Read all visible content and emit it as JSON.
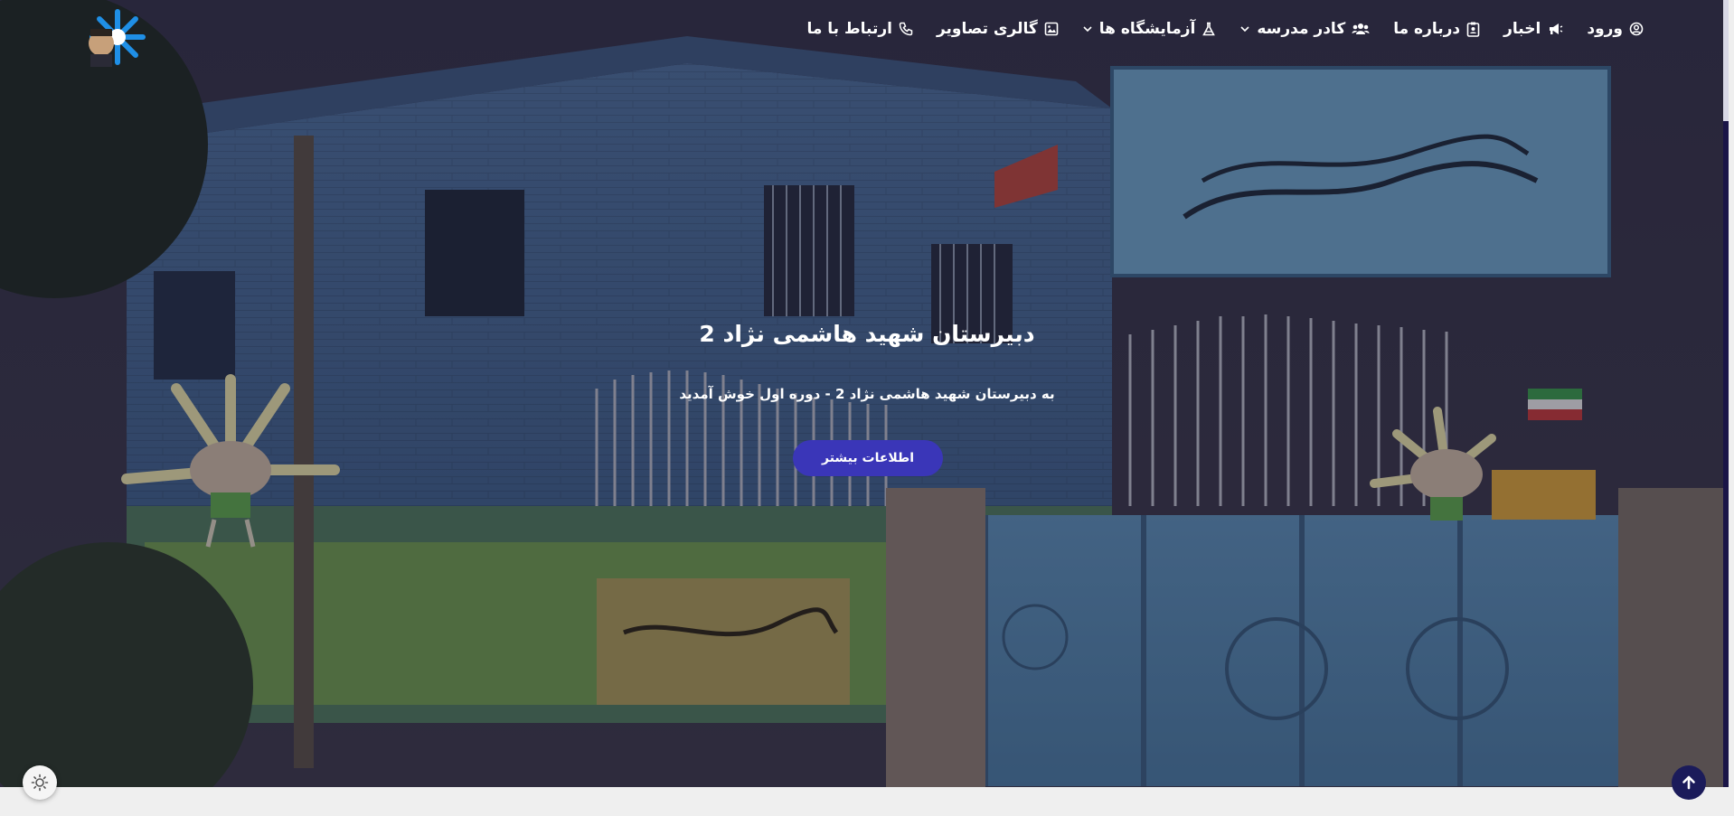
{
  "colors": {
    "accent": "#3a36b8",
    "nav_text": "#ffffff",
    "scroll_top_bg": "#1b1b5a",
    "page_bg": "#efefef"
  },
  "logo": {
    "icon": "school-logo-icon"
  },
  "nav": {
    "items": [
      {
        "label": "ورود",
        "icon": "user-circle-icon",
        "has_dropdown": false
      },
      {
        "label": "اخبار",
        "icon": "megaphone-icon",
        "has_dropdown": false
      },
      {
        "label": "درباره ما",
        "icon": "id-badge-icon",
        "has_dropdown": false
      },
      {
        "label": "کادر مدرسه",
        "icon": "people-icon",
        "has_dropdown": true
      },
      {
        "label": "آزمایشگاه ها",
        "icon": "flask-icon",
        "has_dropdown": true
      },
      {
        "label": "گالری تصاویر",
        "icon": "image-icon",
        "has_dropdown": false
      },
      {
        "label": "ارتباط با ما",
        "icon": "phone-icon",
        "has_dropdown": false
      }
    ]
  },
  "hero": {
    "title": "دبیرستان شهید هاشمی نژاد 2",
    "subtitle": "به دبیرستان شهید هاشمی نژاد 2 - دوره اول خوش آمدید",
    "button_label": "اطلاعات بیشتر"
  },
  "controls": {
    "theme_toggle_icon": "sun-icon",
    "scroll_top_icon": "arrow-up-icon"
  }
}
